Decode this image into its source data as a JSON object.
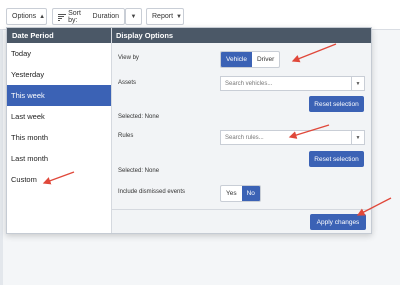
{
  "toolbar": {
    "options_label": "Options",
    "sort_label": "Sort by:",
    "sort_value": "Duration",
    "report_label": "Report"
  },
  "date_period": {
    "title": "Date Period",
    "items": [
      "Today",
      "Yesterday",
      "This week",
      "Last week",
      "This month",
      "Last month",
      "Custom"
    ],
    "selected": "This week"
  },
  "display_options": {
    "title": "Display Options",
    "view_by": {
      "label": "View by",
      "options": [
        "Vehicle",
        "Driver"
      ],
      "selected": "Vehicle"
    },
    "assets": {
      "label": "Assets",
      "placeholder": "Search vehicles...",
      "reset_label": "Reset selection",
      "selected_text": "Selected: None"
    },
    "rules": {
      "label": "Rules",
      "placeholder": "Search rules...",
      "reset_label": "Reset selection",
      "selected_text": "Selected: None"
    },
    "dismissed": {
      "label": "Include dismissed events",
      "options": [
        "Yes",
        "No"
      ],
      "selected": "No"
    },
    "apply_label": "Apply changes"
  },
  "colors": {
    "accent": "#3b62b5",
    "header": "#4b5867",
    "annotation": "#e0483a"
  }
}
